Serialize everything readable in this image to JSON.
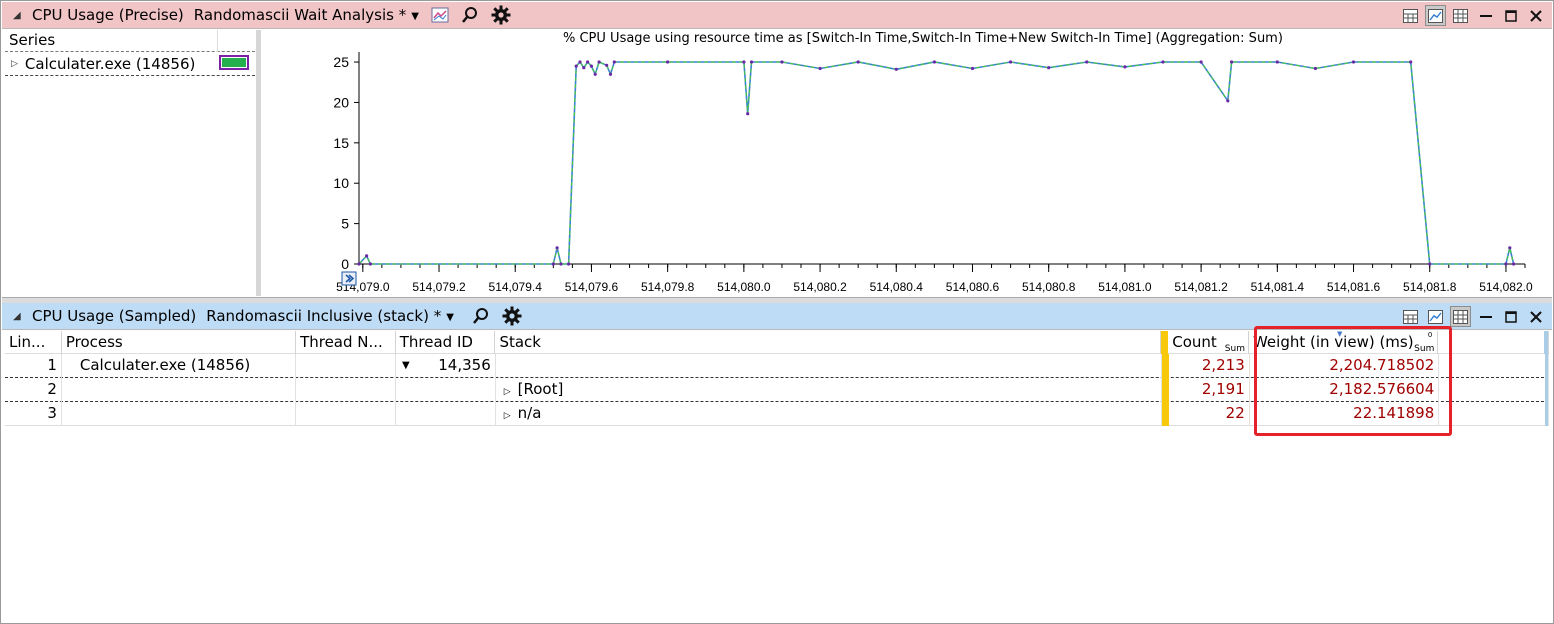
{
  "top_panel": {
    "title": "CPU Usage (Precise)",
    "preset": "Randomascii Wait Analysis *",
    "series_header": "Series",
    "series_item": "Calculater.exe (14856)",
    "series_color": "#23b04d"
  },
  "bottom_panel": {
    "title": "CPU Usage (Sampled)",
    "preset": "Randomascii Inclusive (stack) *"
  },
  "icons": {
    "collapse": "collapse-triangle-icon",
    "dropdown": "dropdown-arrow-icon",
    "graph": "graph-settings-icon",
    "search": "search-icon",
    "settings": "gear-icon",
    "view_both": "graph-and-table-icon",
    "view_graph": "graph-only-icon",
    "view_table": "table-only-icon",
    "minimize": "minimize-icon",
    "maximize": "maximize-icon",
    "close": "close-icon"
  },
  "chart_data": {
    "type": "line",
    "title": "% CPU Usage using resource time as [Switch-In Time,Switch-In Time+New Switch-In Time] (Aggregation: Sum)",
    "x_ticks": [
      "514,079.0",
      "514,079.2",
      "514,079.4",
      "514,079.6",
      "514,079.8",
      "514,080.0",
      "514,080.2",
      "514,080.4",
      "514,080.6",
      "514,080.8",
      "514,081.0",
      "514,081.2",
      "514,081.4",
      "514,081.6",
      "514,081.8",
      "514,082.0"
    ],
    "y_ticks": [
      "0",
      "5",
      "10",
      "15",
      "20",
      "25"
    ],
    "ylim": [
      0,
      25.5
    ],
    "xlim": [
      514078.99,
      514082.05
    ],
    "series": [
      {
        "values": [
          [
            514078.99,
            0
          ],
          [
            514079.01,
            1
          ],
          [
            514079.02,
            0
          ],
          [
            514079.5,
            0
          ],
          [
            514079.51,
            2
          ],
          [
            514079.52,
            0
          ],
          [
            514079.54,
            0
          ],
          [
            514079.56,
            24.5
          ],
          [
            514079.57,
            25
          ],
          [
            514079.58,
            24.3
          ],
          [
            514079.59,
            25
          ],
          [
            514079.6,
            24.5
          ],
          [
            514079.61,
            23.5
          ],
          [
            514079.62,
            25
          ],
          [
            514079.64,
            24.6
          ],
          [
            514079.65,
            23.5
          ],
          [
            514079.66,
            25
          ],
          [
            514079.8,
            25
          ],
          [
            514080.0,
            25
          ],
          [
            514080.01,
            18.6
          ],
          [
            514080.02,
            25
          ],
          [
            514080.1,
            25
          ],
          [
            514080.2,
            24.2
          ],
          [
            514080.3,
            25
          ],
          [
            514080.4,
            24.1
          ],
          [
            514080.5,
            25
          ],
          [
            514080.6,
            24.2
          ],
          [
            514080.7,
            25
          ],
          [
            514080.8,
            24.3
          ],
          [
            514080.9,
            25
          ],
          [
            514081.0,
            24.4
          ],
          [
            514081.1,
            25
          ],
          [
            514081.2,
            25
          ],
          [
            514081.27,
            20.2
          ],
          [
            514081.28,
            25
          ],
          [
            514081.4,
            25
          ],
          [
            514081.5,
            24.2
          ],
          [
            514081.6,
            25
          ],
          [
            514081.75,
            25
          ],
          [
            514081.8,
            0
          ],
          [
            514082.0,
            0
          ],
          [
            514082.01,
            2
          ],
          [
            514082.02,
            0
          ]
        ]
      }
    ]
  },
  "table": {
    "columns": {
      "line": "Lin...",
      "process": "Process",
      "thread_name": "Thread N...",
      "thread_id": "Thread ID",
      "stack": "Stack",
      "count": "Count",
      "count_sum": "Sum",
      "weight": "Weight (in view) (ms)",
      "weight_sum": "Sum",
      "weight_zero": "0"
    },
    "rows": [
      {
        "line": "1",
        "process": "Calculater.exe (14856)",
        "thread_id": "14,356",
        "stack": "",
        "count": "2,213",
        "weight": "2,204.718502"
      },
      {
        "line": "2",
        "process": "",
        "thread_id": "",
        "stack": "[Root]",
        "count": "2,191",
        "weight": "2,182.576604"
      },
      {
        "line": "3",
        "process": "",
        "thread_id": "",
        "stack": "n/a",
        "count": "22",
        "weight": "22.141898"
      }
    ]
  }
}
